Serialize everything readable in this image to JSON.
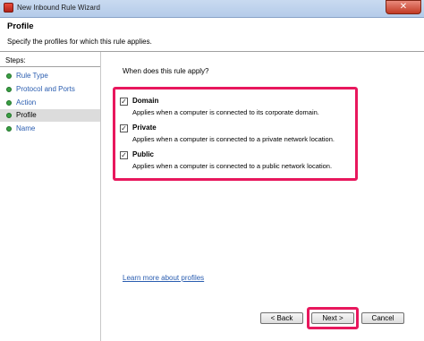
{
  "window": {
    "title": "New Inbound Rule Wizard",
    "close_symbol": "✕"
  },
  "header": {
    "title": "Profile",
    "description": "Specify the profiles for which this rule applies."
  },
  "steps": {
    "label": "Steps:",
    "items": [
      {
        "label": "Rule Type"
      },
      {
        "label": "Protocol and Ports"
      },
      {
        "label": "Action"
      },
      {
        "label": "Profile"
      },
      {
        "label": "Name"
      }
    ]
  },
  "content": {
    "question": "When does this rule apply?",
    "options": [
      {
        "name": "Domain",
        "checked": true,
        "check_mark": "✓",
        "description": "Applies when a computer is connected to its corporate domain."
      },
      {
        "name": "Private",
        "checked": true,
        "check_mark": "✓",
        "description": "Applies when a computer is connected to a private network location."
      },
      {
        "name": "Public",
        "checked": true,
        "check_mark": "✓",
        "description": "Applies when a computer is connected to a public network location."
      }
    ],
    "learn_more": "Learn more about profiles"
  },
  "buttons": {
    "back": "< Back",
    "next": "Next >",
    "cancel": "Cancel"
  },
  "colors": {
    "highlight": "#e8175d",
    "link": "#2a5db0",
    "step_dot": "#3aa043"
  }
}
